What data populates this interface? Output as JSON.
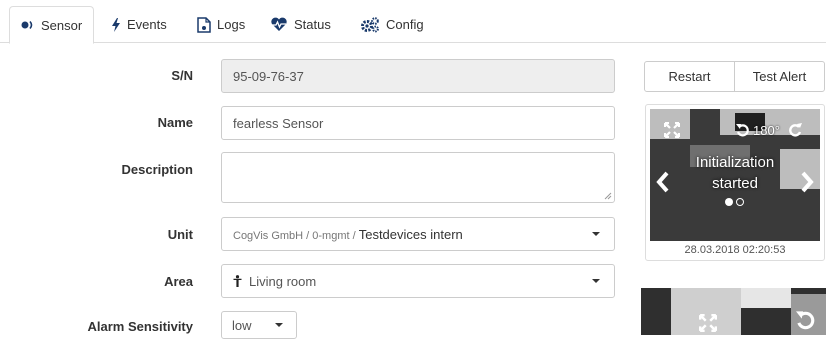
{
  "tabs": [
    {
      "label": "Sensor",
      "icon": "sensor-dot-icon",
      "active": true
    },
    {
      "label": "Events",
      "icon": "lightning-icon",
      "active": false
    },
    {
      "label": "Logs",
      "icon": "document-icon",
      "active": false
    },
    {
      "label": "Status",
      "icon": "heartbeat-icon",
      "active": false
    },
    {
      "label": "Config",
      "icon": "gears-icon",
      "active": false
    }
  ],
  "form": {
    "sn": {
      "label": "S/N",
      "value": "95-09-76-37"
    },
    "name": {
      "label": "Name",
      "value": "fearless Sensor"
    },
    "description": {
      "label": "Description",
      "value": ""
    },
    "unit": {
      "label": "Unit",
      "path": "CogVis GmbH / 0-mgmt / ",
      "value": "Testdevices intern"
    },
    "area": {
      "label": "Area",
      "icon": "person-icon",
      "value": "Living room"
    },
    "alarm_sensitivity": {
      "label": "Alarm Sensitivity",
      "value": "low"
    }
  },
  "actions": {
    "restart": "Restart",
    "test_alert": "Test Alert"
  },
  "camera": {
    "rotation": "180°",
    "status_line1": "Initialization",
    "status_line2": "started",
    "timestamp": "28.03.2018 02:20:53",
    "slide_active_index": 0,
    "slide_count": 2
  },
  "colors": {
    "accent": "#1a3a6b",
    "border": "#cccccc",
    "readonly_bg": "#eeeeee"
  }
}
